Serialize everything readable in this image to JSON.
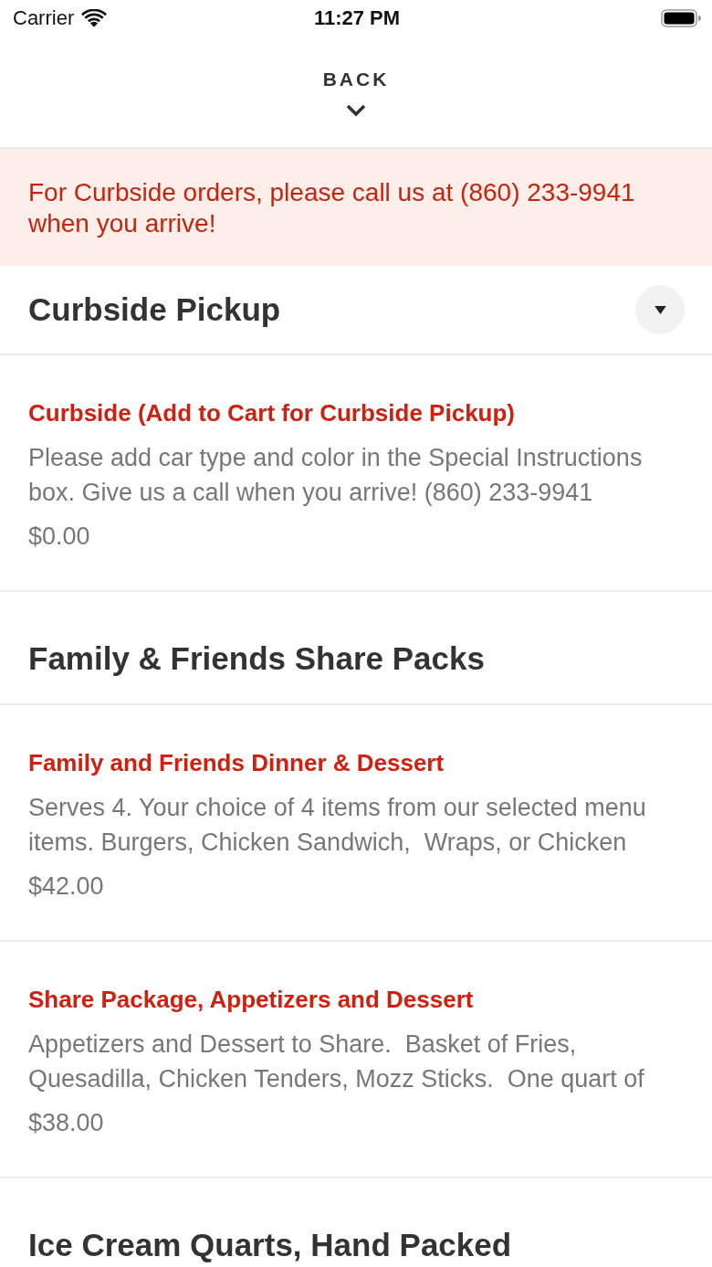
{
  "status_bar": {
    "carrier": "Carrier",
    "time": "11:27 PM"
  },
  "header": {
    "back_label": "BACK"
  },
  "banner": {
    "text": "For Curbside orders, please call us at (860) 233-9941 when you arrive!"
  },
  "sections": [
    {
      "title": "Curbside Pickup",
      "toggle": true,
      "items": [
        {
          "name": "Curbside (Add to Cart for Curbside Pickup)",
          "description": "Please add car type and color in the Special Instructions box. Give us a call when you arrive! (860) 233-9941",
          "price": "$0.00"
        }
      ]
    },
    {
      "title": "Family & Friends Share Packs",
      "toggle": false,
      "items": [
        {
          "name": "Family and Friends Dinner & Dessert",
          "description": "Serves 4. Your choice of 4 items from our selected menu items. Burgers, Chicken Sandwich,  Wraps, or Chicken",
          "price": "$42.00"
        },
        {
          "name": "Share Package, Appetizers and Dessert",
          "description": "Appetizers and Dessert to Share.  Basket of Fries, Quesadilla, Chicken Tenders, Mozz Sticks.  One quart of",
          "price": "$38.00"
        }
      ]
    },
    {
      "title": "Ice Cream Quarts, Hand Packed",
      "toggle": false
    }
  ]
}
